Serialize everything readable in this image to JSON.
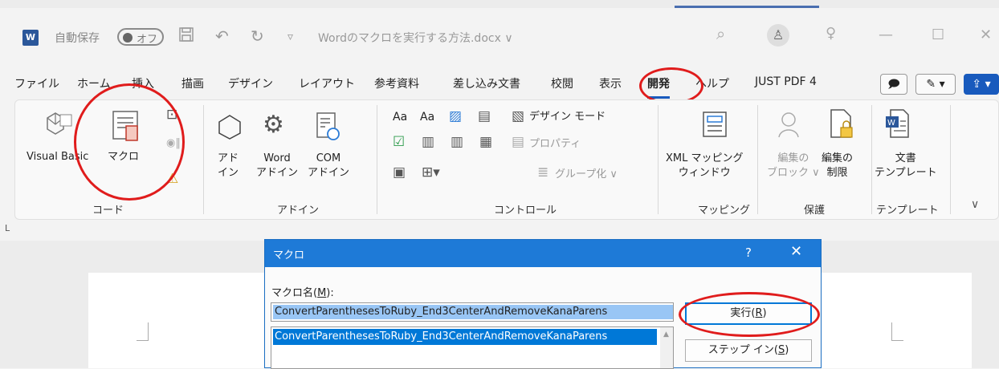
{
  "titlebar": {
    "app_icon": "W",
    "autosave_label": "自動保存",
    "autosave_state": "オフ",
    "doc_title": "Wordのマクロを実行する方法.docx ∨",
    "icons": [
      "save-icon",
      "undo-icon",
      "redo-icon",
      "customize-icon",
      "search-icon",
      "account-icon",
      "lightbulb-icon",
      "minimize-icon",
      "maximize-icon",
      "close-icon"
    ]
  },
  "tabs": [
    "ファイル",
    "ホーム",
    "挿入",
    "描画",
    "デザイン",
    "レイアウト",
    "参考資料",
    "差し込み文書",
    "校閲",
    "表示",
    "開発",
    "ヘルプ",
    "JUST PDF 4"
  ],
  "active_tab": "開発",
  "ribbon": {
    "code": {
      "visual_basic": "Visual Basic",
      "macro": "マクロ",
      "label": "コード"
    },
    "addins": {
      "addin_1": "アド",
      "addin_2": "イン",
      "word_1": "Word",
      "word_2": "アドイン",
      "com_1": "COM",
      "com_2": "アドイン",
      "label": "アドイン"
    },
    "controls": {
      "aa1": "Aa",
      "aa2": "Aa",
      "design_mode": "デザイン モード",
      "properties": "プロパティ",
      "group": "グループ化 ∨",
      "label": "コントロール"
    },
    "mapping": {
      "xml_1": "XML マッピング",
      "xml_2": "ウィンドウ",
      "label": "マッピング"
    },
    "protect": {
      "block_1": "編集の",
      "block_2": "ブロック ∨",
      "restrict_1": "編集の",
      "restrict_2": "制限",
      "label": "保護"
    },
    "template": {
      "doc_1": "文書",
      "doc_2": "テンプレート",
      "label": "テンプレート"
    }
  },
  "ruler_mark": "L",
  "dialog": {
    "title": "マクロ",
    "help": "?",
    "close": "✕",
    "name_label_pre": "マクロ名(",
    "name_label_key": "M",
    "name_label_post": "):",
    "macro_name_value": "ConvertParenthesesToRuby_End3CenterAndRemoveKanaParens",
    "list_item": "ConvertParenthesesToRuby_End3CenterAndRemoveKanaParens",
    "run_pre": "実行(",
    "run_key": "R",
    "run_post": ")",
    "step_pre": "ステップ イン(",
    "step_key": "S",
    "step_post": ")"
  },
  "colors": {
    "accent": "#185abd",
    "annotation": "#e01c1c",
    "dialog_title": "#1e7ad7"
  }
}
